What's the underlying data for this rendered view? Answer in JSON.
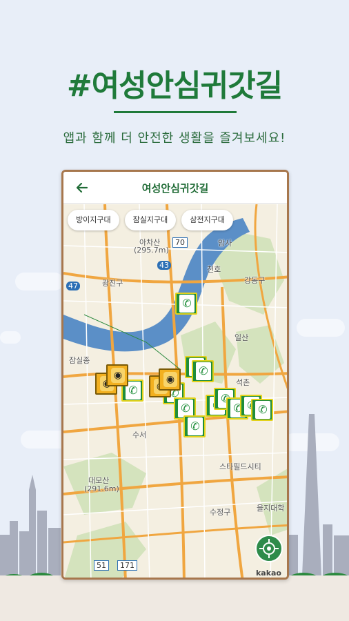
{
  "hero": {
    "title": "#여성안심귀갓길",
    "subtitle": "앱과 함께 더 안전한 생활을 즐겨보세요!"
  },
  "appbar": {
    "title": "여성안심귀갓길",
    "back_icon": "arrow-left-icon"
  },
  "chips": [
    "방이지구대",
    "잠실지구대",
    "삼전지구대"
  ],
  "map_labels": {
    "achasan": "아차산",
    "achasan_elev": "(295.7m)",
    "gwangjin": "광진구",
    "gangdong": "강동구",
    "amsa": "암사",
    "cheonho": "천호",
    "ilsan": "일산",
    "jamsil": "잠실종",
    "seokchon": "석촌",
    "suseo": "수서",
    "starfield": "스타필드시티",
    "daemosan": "대모산",
    "daemosan_elev": "(291.6m)",
    "sujeong": "수정구",
    "euljidae": "을지대학",
    "road_47": "47",
    "road_43": "43",
    "road_70": "70",
    "road_51": "51",
    "road_171": "171"
  },
  "attribution": "kakao",
  "colors": {
    "brand_green": "#1f7a3a",
    "frame_border": "#a7774d",
    "river": "#5b8fc7",
    "road": "#f0a640",
    "marker_green": "#1f8d3a",
    "marker_yellow": "#f2b020"
  }
}
